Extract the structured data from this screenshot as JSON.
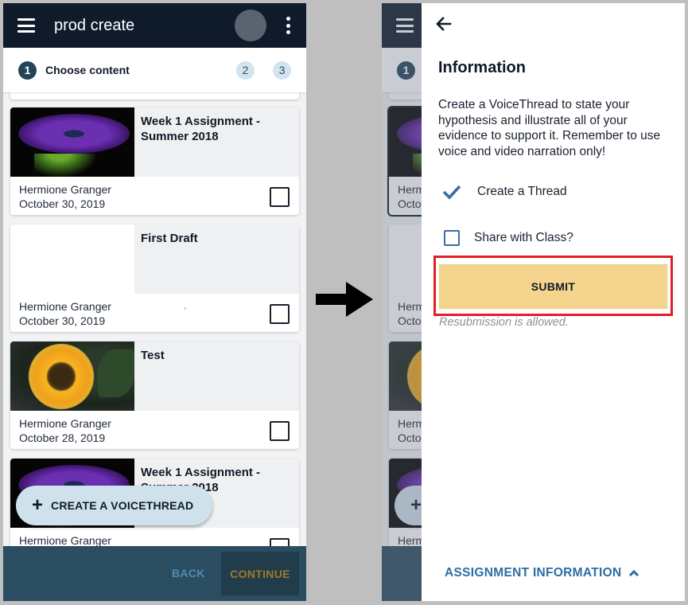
{
  "left_screen": {
    "appbar": {
      "title": "prod create",
      "menu_icon": "hamburger-menu-icon",
      "overflow_icon": "more-vert-icon"
    },
    "stepper": {
      "steps": [
        {
          "number": "1",
          "label": "Choose content",
          "active": true
        },
        {
          "number": "2",
          "label": "",
          "active": false
        },
        {
          "number": "3",
          "label": "",
          "active": false
        }
      ]
    },
    "cards": [
      {
        "title": "Week 1 Assignment - Summer 2018",
        "author": "Hermione Granger",
        "date": "October 30, 2019",
        "thumbnail": "purple-flower",
        "checked": false
      },
      {
        "title": "First Draft",
        "author": "Hermione Granger",
        "date": "October 30, 2019",
        "thumbnail": "blank",
        "checked": false
      },
      {
        "title": "Test",
        "author": "Hermione Granger",
        "date": "October 28, 2019",
        "thumbnail": "sunflower",
        "checked": false
      },
      {
        "title": "Week 1 Assignment - Summer 2018",
        "author": "Hermione Granger",
        "date": "",
        "thumbnail": "purple-flower",
        "checked": false
      }
    ],
    "fab": {
      "icon": "plus-icon",
      "label": "CREATE A VOICETHREAD"
    },
    "bottombar": {
      "back_label": "BACK",
      "continue_label": "CONTINUE"
    }
  },
  "right_screen": {
    "background_steps": [
      "1"
    ],
    "background_cards": [
      {
        "author_partial": "Herm",
        "date_partial": "Octo",
        "selected": true
      },
      {
        "author_partial": "Herm",
        "date_partial": "Octo",
        "selected": false
      },
      {
        "author_partial": "Herm",
        "date_partial": "Octo",
        "selected": false
      },
      {
        "author_partial": "Herm",
        "date_partial": "",
        "selected": false
      }
    ],
    "drawer": {
      "back_icon": "arrow-left-icon",
      "title": "Information",
      "description": "Create a VoiceThread to state your hypothesis and illustrate all of your evidence to support it. Remember to use voice and video narration only!",
      "options": [
        {
          "label": "Create a Thread",
          "state": "checked",
          "icon": "checkmark-icon"
        },
        {
          "label": "Share with Class?",
          "state": "unchecked",
          "icon": "checkbox-icon"
        }
      ],
      "submit_label": "SUBMIT",
      "resubmission_note": "Resubmission is allowed.",
      "assignment_info_label": "ASSIGNMENT INFORMATION",
      "assignment_info_icon": "chevron-up-icon"
    }
  },
  "annotations": {
    "transition_arrow": "arrow-right-icon",
    "highlight_color": "#e21f26"
  },
  "colors": {
    "appbar": "#0f1b2b",
    "bottombar": "#2b4d61",
    "step_active": "#24445a",
    "step_inactive": "#d2e4ef",
    "fab": "#cfe1ec",
    "back_text": "#4e8db6",
    "continue_text": "#a0782a",
    "submit": "#f5d48e",
    "link_blue": "#2d6da3"
  }
}
